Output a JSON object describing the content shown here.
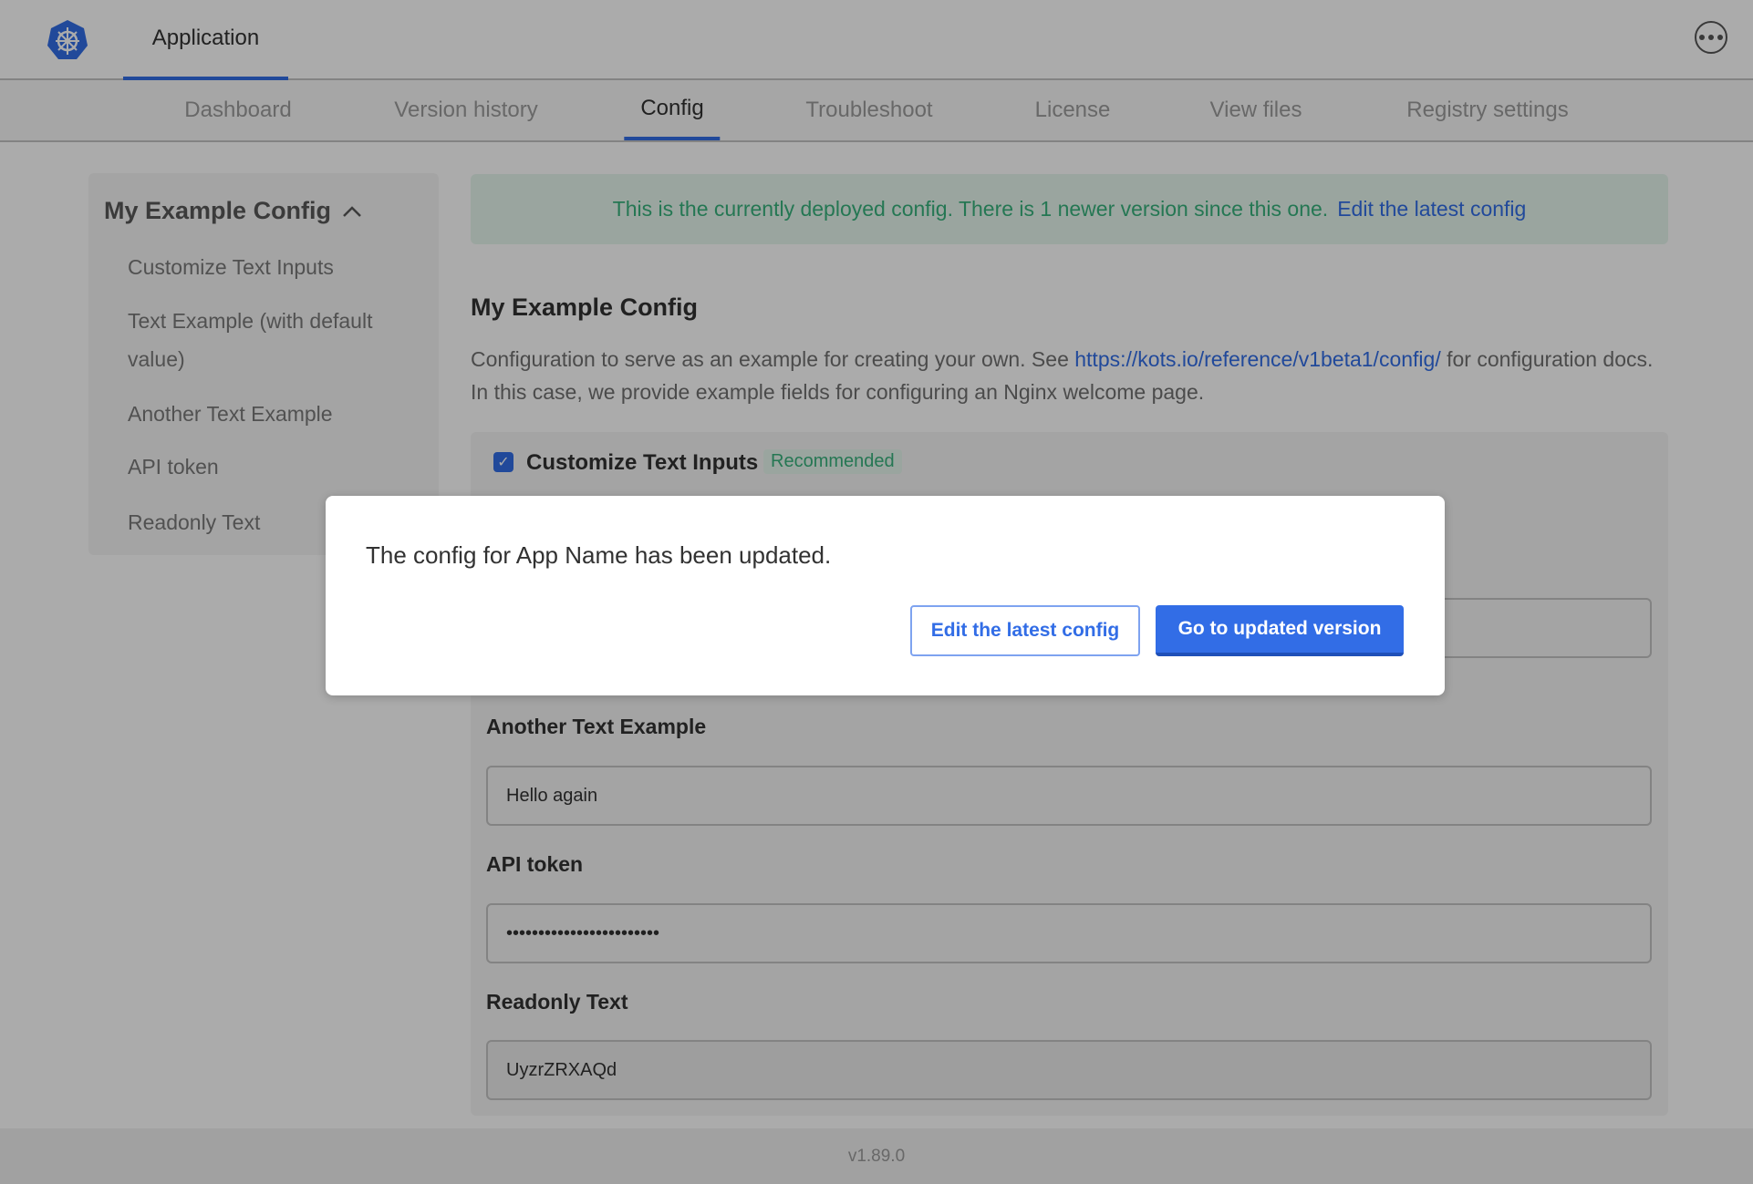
{
  "header": {
    "app_tab": "Application",
    "logo_icon": "helm-wheel-icon",
    "menu_icon": "more-horizontal-icon",
    "accent": "#326de6"
  },
  "nav": {
    "tabs": [
      {
        "label": "Dashboard",
        "active": false
      },
      {
        "label": "Version history",
        "active": false
      },
      {
        "label": "Config",
        "active": true
      },
      {
        "label": "Troubleshoot",
        "active": false
      },
      {
        "label": "License",
        "active": false
      },
      {
        "label": "View files",
        "active": false
      },
      {
        "label": "Registry settings",
        "active": false
      }
    ]
  },
  "sidebar": {
    "title": "My Example Config",
    "items": [
      {
        "label": "Customize Text Inputs"
      },
      {
        "label": "Text Example (with default value)"
      },
      {
        "label": "Another Text Example"
      },
      {
        "label": "API token"
      },
      {
        "label": "Readonly Text"
      }
    ]
  },
  "banner": {
    "text": "This is the currently deployed config. There is 1 newer version since this one.",
    "link": "Edit the latest config"
  },
  "main": {
    "title": "My Example Config",
    "desc_before": "Configuration to serve as an example for creating your own. See ",
    "desc_link": "https://kots.io/reference/v1beta1/config/",
    "desc_after": " for configuration docs. In this case, we provide example fields for configuring an Nginx welcome page.",
    "group": {
      "checkbox_label": "Customize Text Inputs",
      "checked": true,
      "badge": "Recommended",
      "fields": [
        {
          "label": "Another Text Example",
          "value": "Hello again"
        },
        {
          "label": "API token",
          "value": "••••••••••••••••••••••••"
        },
        {
          "label": "Readonly Text",
          "value": "UyzrZRXAQd"
        }
      ]
    }
  },
  "footer": {
    "version": "v1.89.0"
  },
  "modal": {
    "message": "The config for App Name has been updated.",
    "edit_button": "Edit the latest config",
    "go_button": "Go to updated version"
  }
}
